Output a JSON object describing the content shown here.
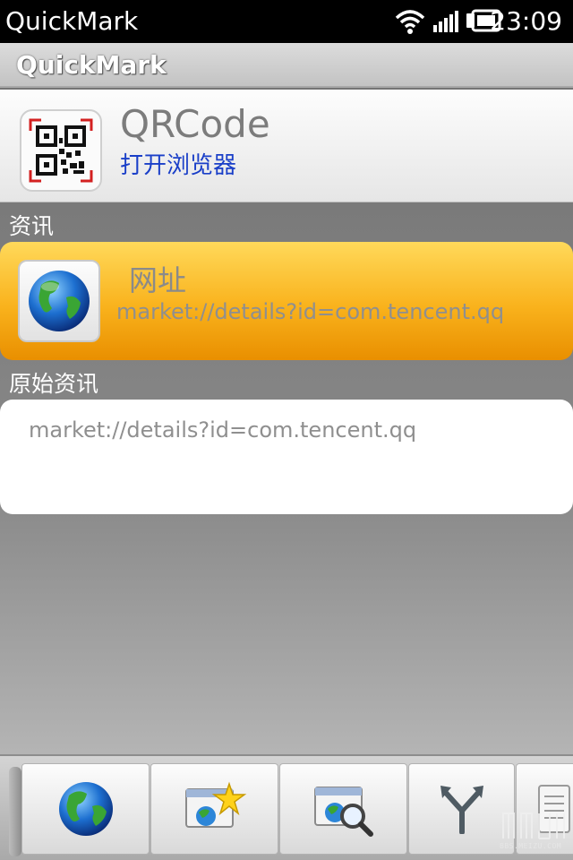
{
  "status_bar": {
    "app_name": "QuickMark",
    "time": "23:09",
    "icons": [
      "wifi-icon",
      "signal-icon",
      "battery-icon"
    ]
  },
  "title_bar": {
    "title": "QuickMark"
  },
  "header": {
    "icon": "qr-code-icon",
    "type_name": "QRCode",
    "action_link": "打开浏览器"
  },
  "info_section": {
    "label": "资讯",
    "card": {
      "icon": "globe-icon",
      "title": "网址",
      "value": "market://details?id=com.tencent.qq"
    }
  },
  "raw_section": {
    "label": "原始资讯",
    "value": "market://details?id=com.tencent.qq"
  },
  "toolbar": {
    "buttons": [
      {
        "name": "open-browser",
        "icon": "globe-icon"
      },
      {
        "name": "add-bookmark",
        "icon": "browser-star-icon"
      },
      {
        "name": "web-search",
        "icon": "browser-search-icon"
      },
      {
        "name": "share",
        "icon": "share-fork-icon"
      },
      {
        "name": "more",
        "icon": "notes-icon"
      }
    ]
  },
  "watermark": {
    "text": "BBS.MEIZU.COM"
  },
  "colors": {
    "link": "#1a3fc8",
    "card_orange": "#f9b21c",
    "status_bar": "#000000"
  }
}
